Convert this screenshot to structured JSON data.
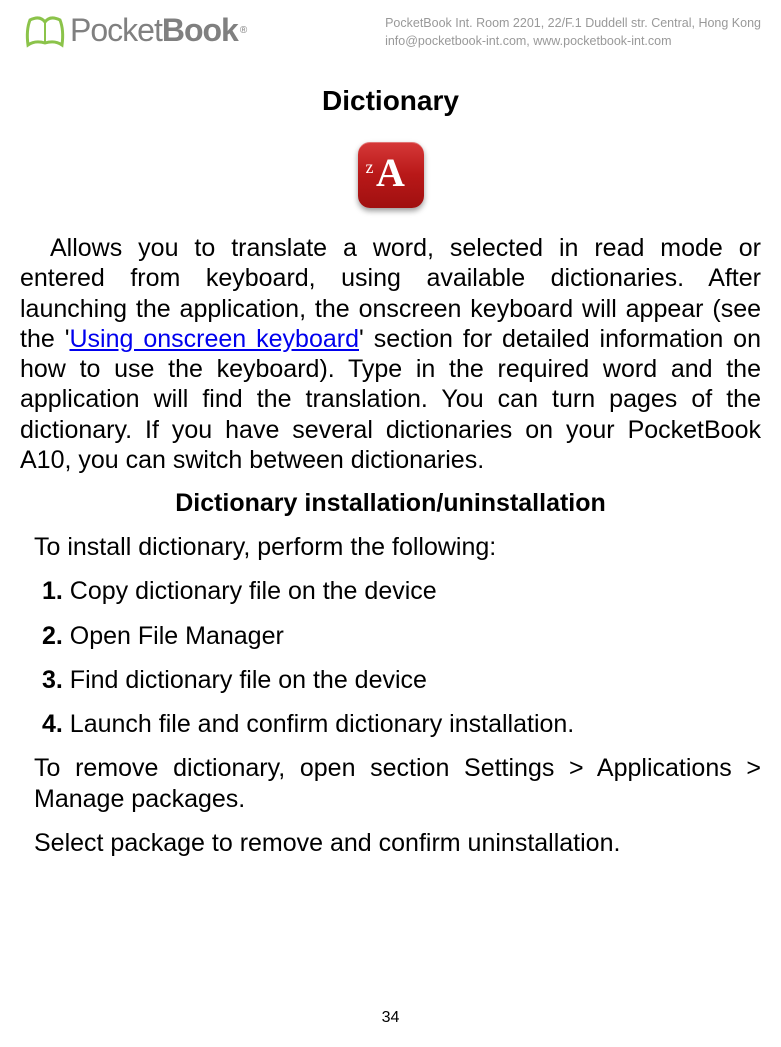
{
  "header": {
    "logo_text1": "Pocket",
    "logo_text2": "Book",
    "logo_r": "®",
    "company_line1": "PocketBook Int. Room 2201, 22/F.1 Duddell str. Central, Hong Kong",
    "company_line2": "info@pocketbook-int.com, www.pocketbook-int.com"
  },
  "title": "Dictionary",
  "app_icon_letter": "A",
  "app_icon_sub": "z",
  "para1_before": "Allows you to translate a word, selected in read mode or entered from keyboard, using available dictionaries. After launching the application, the onscreen keyboard will appear (see the '",
  "para1_link": "Using onscreen keyboard",
  "para1_after": "' section for detailed information on how to use the keyboard). Type in the required word and the application will find the translation. You can turn pages of the dictionary. If you have several dictionaries on your PocketBook A10, you can switch between dictionaries.",
  "subtitle": "Dictionary installation/uninstallation",
  "install_intro": "To install dictionary, perform the following:",
  "steps": [
    {
      "num": "1.",
      "text": " Copy dictionary file on the device"
    },
    {
      "num": "2.",
      "text": " Open File Manager"
    },
    {
      "num": "3.",
      "text": " Find dictionary file on the device"
    },
    {
      "num": "4.",
      "text": " Launch file and confirm dictionary installation."
    }
  ],
  "remove_para": "To remove dictionary, open section Settings > Applications > Manage packages.",
  "select_para": "Select package to remove and confirm uninstallation.",
  "page_num": "34"
}
